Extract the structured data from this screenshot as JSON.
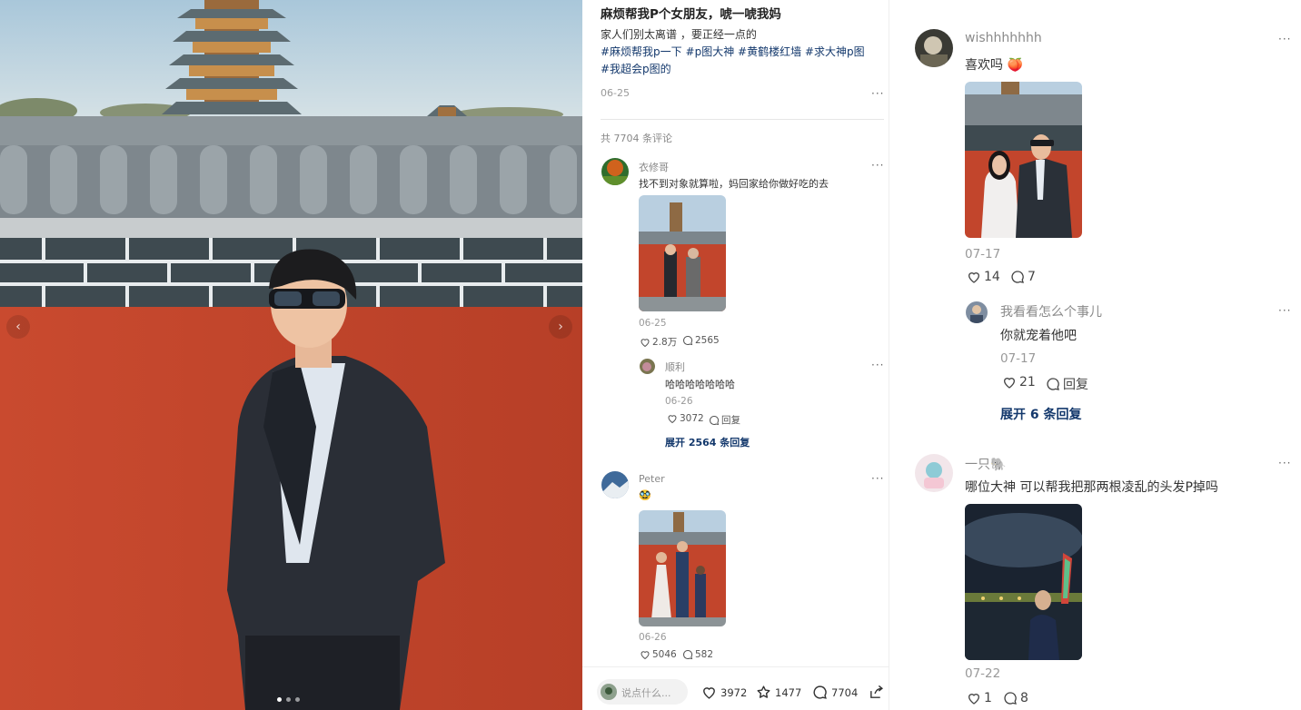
{
  "note": {
    "title": "麻烦帮我P个女朋友，唬一唬我妈",
    "desc_line1": "家人们别太离谱 ，要正经一点的",
    "tags": [
      "#麻烦帮我p一下",
      "#p图大神",
      "#黄鹤楼红墙",
      "#求大神p图",
      "#我超会p图的"
    ],
    "date": "06-25",
    "more_label": "···",
    "comment_count": "共 7704 条评论"
  },
  "comments": [
    {
      "name": "衣修哥",
      "text": "找不到对象就算啦，妈回家给你做好吃的去",
      "date": "06-25",
      "likes": "2.8万",
      "replies": "2565",
      "reply": {
        "name": "顺利",
        "text": "哈哈哈哈哈哈哈",
        "date": "06-26",
        "likes": "3072",
        "reply_label": "回复"
      },
      "expand": "展开 2564 条回复"
    },
    {
      "name": "Peter",
      "text": "🥸",
      "date": "06-26",
      "likes": "5046",
      "replies": "582"
    }
  ],
  "bottom_bar": {
    "placeholder": "说点什么...",
    "likes": "3972",
    "stars": "1477",
    "comments": "7704"
  },
  "right_comments": [
    {
      "name": "wishhhhhhh",
      "text": "喜欢吗 🍑",
      "date": "07-17",
      "likes": "14",
      "replies": "7",
      "reply": {
        "name": "我看看怎么个事儿",
        "text": "你就宠着他吧",
        "date": "07-17",
        "likes": "21",
        "reply_label": "回复"
      },
      "expand": "展开 6 条回复"
    },
    {
      "name": "一只🐘",
      "text": "哪位大神 可以帮我把那两根凌乱的头发P掉吗",
      "date": "07-22",
      "likes": "1",
      "replies": "8"
    }
  ],
  "icons": {
    "like": "heart-icon",
    "comment": "comment-bubble-icon",
    "star": "star-icon",
    "share": "share-icon",
    "prev": "chevron-left-icon",
    "next": "chevron-right-icon"
  },
  "colors": {
    "tag": "#13386c",
    "wall_red": "#c2452c",
    "text_muted": "#999999"
  },
  "carousel": {
    "current": 1,
    "total": 3
  }
}
